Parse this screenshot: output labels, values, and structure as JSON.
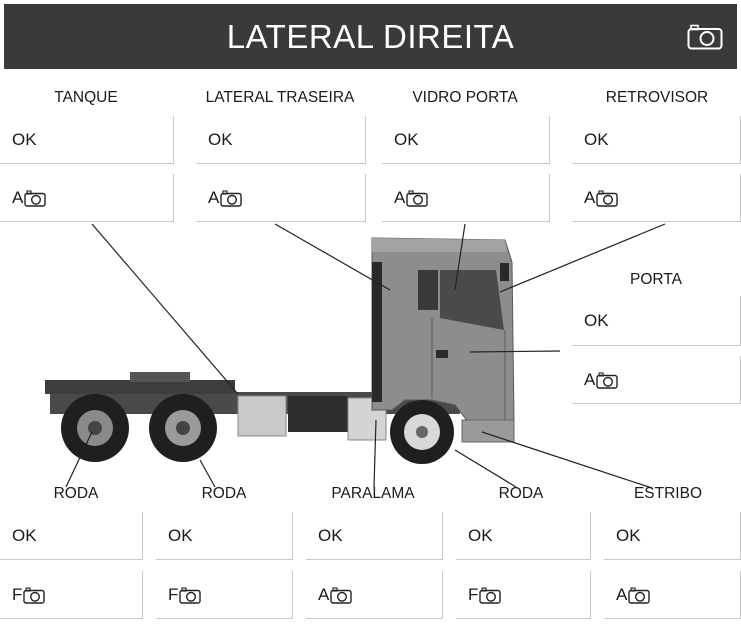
{
  "header": {
    "title": "LATERAL DIREITA",
    "camera_icon": "camera-icon"
  },
  "top_items": [
    {
      "label": "TANQUE",
      "status": "OK",
      "photo": "A"
    },
    {
      "label": "LATERAL TRASEIRA",
      "status": "OK",
      "photo": "A"
    },
    {
      "label": "VIDRO PORTA",
      "status": "OK",
      "photo": "A"
    },
    {
      "label": "RETROVISOR",
      "status": "OK",
      "photo": "A"
    }
  ],
  "porta": {
    "label": "PORTA",
    "status": "OK",
    "photo": "A"
  },
  "bottom_items": [
    {
      "label": "RODA",
      "status": "OK",
      "photo": "F"
    },
    {
      "label": "RODA",
      "status": "OK",
      "photo": "F"
    },
    {
      "label": "PARALAMA",
      "status": "OK",
      "photo": "A"
    },
    {
      "label": "RODA",
      "status": "OK",
      "photo": "F"
    },
    {
      "label": "ESTRIBO",
      "status": "OK",
      "photo": "A"
    }
  ],
  "colors": {
    "header_bg": "#3a3a3a",
    "header_text": "#ffffff",
    "border": "#c9c9c9"
  }
}
